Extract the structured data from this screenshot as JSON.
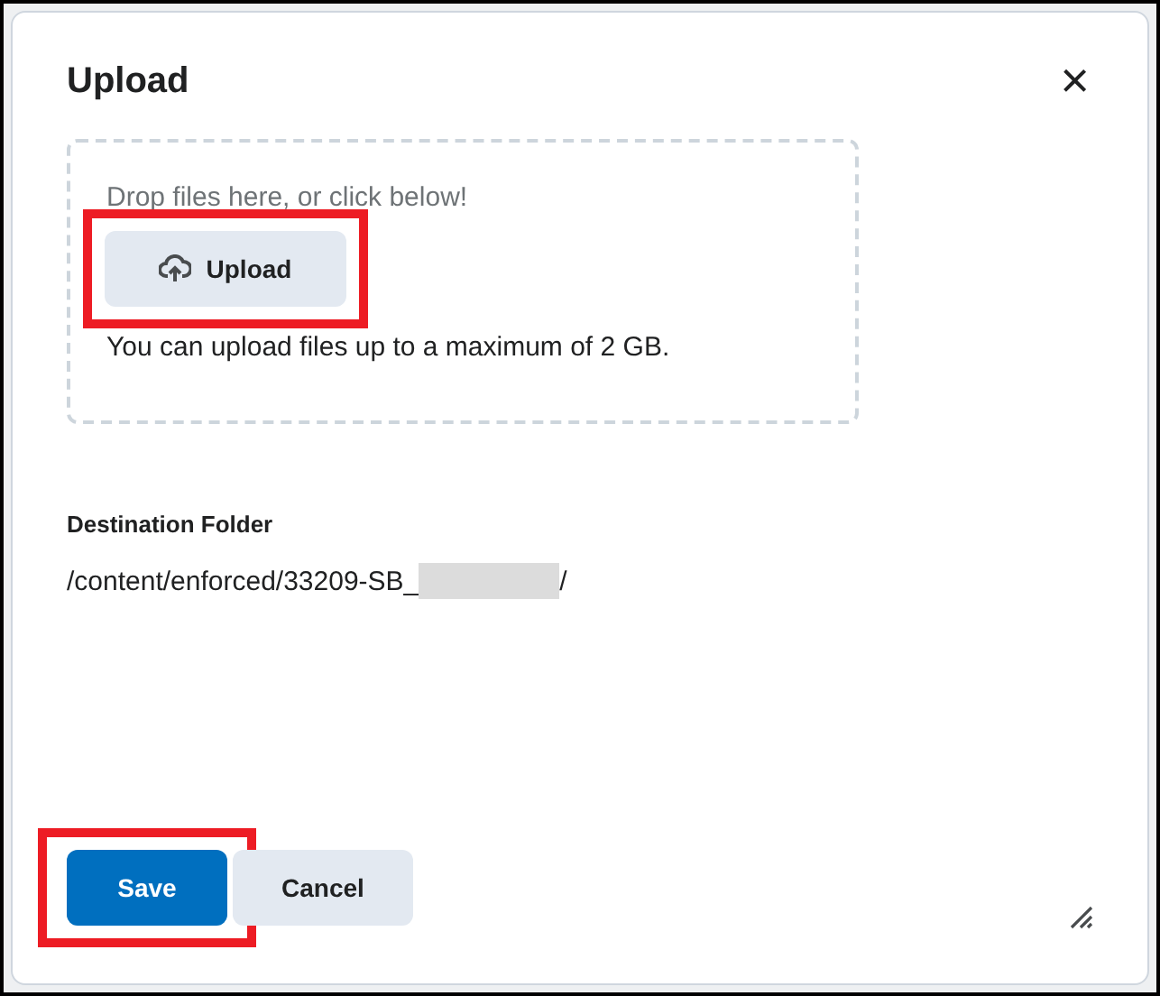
{
  "dialog": {
    "title": "Upload",
    "close": "×"
  },
  "dropzone": {
    "hint": "Drop files here, or click below!",
    "button": "Upload",
    "note": "You can upload files up to a maximum of 2 GB.",
    "highlighted": true
  },
  "destination": {
    "label": "Destination Folder",
    "path": [
      {
        "kind": "text",
        "text": "/content/enforced/33209-SB_"
      },
      {
        "kind": "redacted"
      },
      {
        "kind": "text",
        "text": "/"
      }
    ]
  },
  "buttons": [
    {
      "label": "Save",
      "kind": "primary",
      "highlighted": true
    },
    {
      "label": "Cancel",
      "kind": "secondary",
      "highlighted": false
    }
  ]
}
